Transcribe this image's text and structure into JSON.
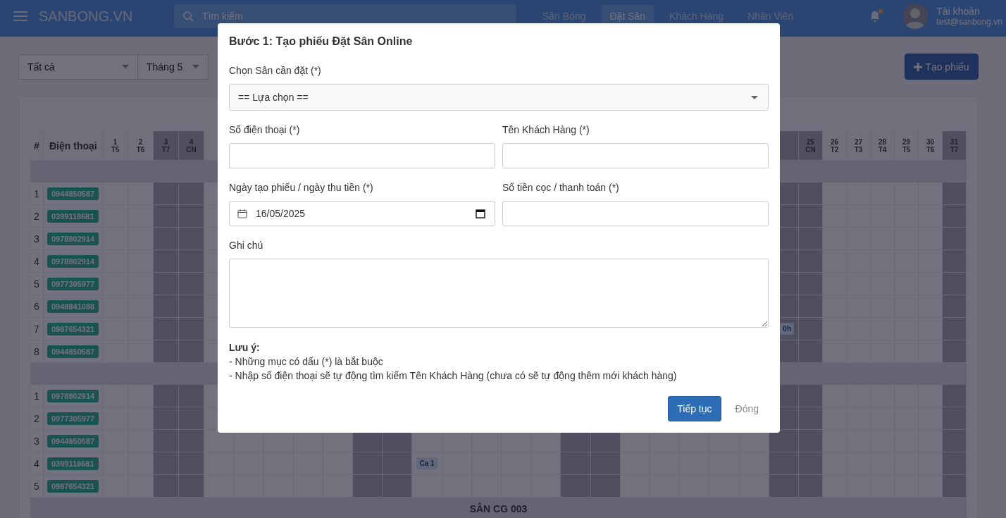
{
  "header": {
    "logo": "SANBONG.VN",
    "search": {
      "placeholder": "Tìm kiếm"
    },
    "nav": [
      {
        "label": "Sân Bóng",
        "selected": false
      },
      {
        "label": "Đặt Sân",
        "selected": true
      },
      {
        "label": "Khách Hàng",
        "selected": false
      },
      {
        "label": "Nhân Viên",
        "selected": false
      }
    ],
    "notifications": {
      "unread": true
    },
    "account": {
      "name": "Tài khoản",
      "email": "test@sanbong.vn"
    }
  },
  "toolbar": {
    "filters": [
      {
        "value": "Tất cả"
      },
      {
        "value": "Tháng 5"
      }
    ],
    "create_button": "Tạo phiếu"
  },
  "schedule": {
    "index_header": "#",
    "phone_header": "Điện thoại",
    "columns": [
      {
        "day": "1",
        "weekday": "T5",
        "weekend": false
      },
      {
        "day": "2",
        "weekday": "T6",
        "weekend": false
      },
      {
        "day": "3",
        "weekday": "T7",
        "weekend": true
      },
      {
        "day": "4",
        "weekday": "CN",
        "weekend": true
      },
      {
        "weekend": false
      },
      {
        "weekend": false
      },
      {
        "weekend": false
      },
      {
        "weekend": false
      },
      {
        "weekend": false
      },
      {
        "weekend": true
      },
      {
        "weekend": true
      },
      {
        "weekend": false
      },
      {
        "weekend": false
      },
      {
        "weekend": false
      },
      {
        "weekend": false
      },
      {
        "weekend": false
      },
      {
        "weekend": true
      },
      {
        "weekend": true
      },
      {
        "weekend": false
      },
      {
        "weekend": false
      },
      {
        "weekend": false
      },
      {
        "weekend": false
      },
      {
        "weekend": false
      },
      {
        "weekend": true
      },
      {
        "day": "25",
        "weekday": "CN",
        "weekend": true
      },
      {
        "day": "26",
        "weekday": "T2",
        "weekend": false
      },
      {
        "day": "27",
        "weekday": "T3",
        "weekend": false
      },
      {
        "day": "28",
        "weekday": "T4",
        "weekend": false
      },
      {
        "day": "29",
        "weekday": "T5",
        "weekend": false
      },
      {
        "day": "30",
        "weekday": "T6",
        "weekend": false
      },
      {
        "day": "31",
        "weekday": "T7",
        "weekend": true
      }
    ],
    "groups": [
      {
        "rows": [
          {
            "index": "1",
            "phone": "0944850587"
          },
          {
            "index": "2",
            "phone": "0399118681"
          },
          {
            "index": "3",
            "phone": "0978802914"
          },
          {
            "index": "4",
            "phone": "0978802914"
          },
          {
            "index": "5",
            "phone": "0977305977"
          },
          {
            "index": "6",
            "phone": "0948841088"
          },
          {
            "index": "7",
            "phone": "0987654321",
            "bookings": {
              "24": "0h"
            }
          },
          {
            "index": "8",
            "phone": "0944850587"
          }
        ]
      },
      {
        "rows": [
          {
            "index": "1",
            "phone": "0978802914"
          },
          {
            "index": "2",
            "phone": "0977305977"
          },
          {
            "index": "3",
            "phone": "0944850587"
          },
          {
            "index": "4",
            "phone": "0399118681",
            "bookings": {
              "12": "Ca 1"
            }
          },
          {
            "index": "5",
            "phone": "0987654321"
          }
        ]
      },
      {
        "title": "SÂN CG 003"
      }
    ]
  },
  "modal": {
    "title": "Bước 1: Tạo phiếu Đặt Sân Online",
    "court": {
      "label": "Chọn Sân cần đặt (*)",
      "value": "== Lựa chọn =="
    },
    "phone": {
      "label": "Số điện thoại (*)"
    },
    "customer": {
      "label": "Tên Khách Hàng (*)"
    },
    "date": {
      "label": "Ngày tạo phiếu / ngày thu tiền (*)",
      "value": "16/05/2025"
    },
    "deposit": {
      "label": "Số tiền cọc / thanh toán (*)"
    },
    "note": {
      "label": "Ghi chú"
    },
    "notes_title": "Lưu ý:",
    "notes": [
      "- Những mục có dấu (*) là bắt buộc",
      "- Nhập số điện thoại sẽ tự động tìm kiếm Tên Khách Hàng (chưa có sẽ tự động thêm mới khách hàng)"
    ],
    "primary_button": "Tiếp tục",
    "close_button": "Đóng"
  }
}
